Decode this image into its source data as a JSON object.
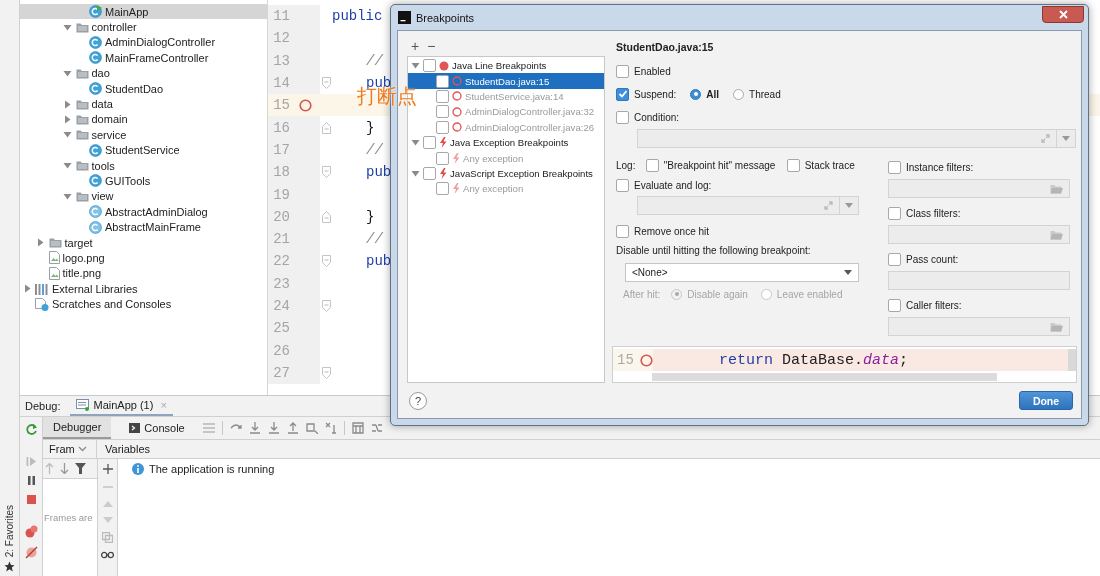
{
  "ide": {
    "favorites_label": "2: Favorites",
    "project_tree": [
      {
        "children": [
          {
            "children": [
              {
                "children": [
                  {
                    "children": [
                      {
                        "label": "MainApp",
                        "kind": "main_class",
                        "selected": true
                      }
                    ]
                  },
                  {
                    "label": "controller",
                    "kind": "folder",
                    "expanded": true,
                    "selected": false,
                    "children": [
                      {
                        "label": "AdminDialogController",
                        "kind": "class",
                        "selected": false
                      },
                      {
                        "label": "MainFrameController",
                        "kind": "class",
                        "selected": false
                      }
                    ]
                  },
                  {
                    "label": "dao",
                    "kind": "folder",
                    "expanded": true,
                    "selected": false,
                    "children": [
                      {
                        "label": "StudentDao",
                        "kind": "class",
                        "selected": false
                      }
                    ]
                  },
                  {
                    "label": "data",
                    "kind": "folder",
                    "expanded": false,
                    "selected": false
                  },
                  {
                    "label": "domain",
                    "kind": "folder",
                    "expanded": false,
                    "selected": false
                  },
                  {
                    "label": "service",
                    "kind": "folder",
                    "expanded": true,
                    "selected": false,
                    "children": [
                      {
                        "label": "StudentService",
                        "kind": "class",
                        "selected": false
                      }
                    ]
                  },
                  {
                    "label": "tools",
                    "kind": "folder",
                    "expanded": true,
                    "selected": false,
                    "children": [
                      {
                        "label": "GUITools",
                        "kind": "class",
                        "selected": false
                      }
                    ]
                  },
                  {
                    "label": "view",
                    "kind": "folder",
                    "expanded": true,
                    "selected": false,
                    "children": [
                      {
                        "label": "AbstractAdminDialog",
                        "kind": "abstract_class",
                        "selected": false
                      },
                      {
                        "label": "AbstractMainFrame",
                        "kind": "abstract_class",
                        "selected": false
                      }
                    ]
                  }
                ]
              }
            ]
          },
          {
            "label": "target",
            "kind": "folder",
            "expanded": false,
            "selected": false
          },
          {
            "label": "logo.png",
            "kind": "image",
            "selected": false
          },
          {
            "label": "title.png",
            "kind": "image",
            "selected": false
          }
        ]
      },
      {
        "label": "External Libraries",
        "kind": "libraries",
        "expanded": false,
        "selected": false
      },
      {
        "label": "Scratches and Consoles",
        "kind": "scratches",
        "selected": false
      }
    ],
    "editor": {
      "annotation": "打断点",
      "lines": [
        {
          "number": "11",
          "code": "public",
          "kind": "declaration",
          "breakpoint": false,
          "current": false,
          "fold_start": false,
          "fold_end": false
        },
        {
          "number": "12",
          "breakpoint": false,
          "current": false,
          "fold_start": false,
          "fold_end": false
        },
        {
          "number": "13",
          "code": "//",
          "kind": "comment",
          "breakpoint": false,
          "current": false,
          "fold_start": false,
          "fold_end": false
        },
        {
          "number": "14",
          "code": "pub",
          "kind": "keyword",
          "breakpoint": false,
          "current": false,
          "fold_start": true,
          "fold_end": false
        },
        {
          "number": "15",
          "breakpoint": true,
          "current": true,
          "fold_start": false,
          "fold_end": false
        },
        {
          "number": "16",
          "code": "}",
          "kind": "brace",
          "breakpoint": false,
          "current": false,
          "fold_start": false,
          "fold_end": true
        },
        {
          "number": "17",
          "code": "//",
          "kind": "comment",
          "breakpoint": false,
          "current": false,
          "fold_start": false,
          "fold_end": false
        },
        {
          "number": "18",
          "code": "pub",
          "kind": "keyword",
          "breakpoint": false,
          "current": false,
          "fold_start": true,
          "fold_end": false
        },
        {
          "number": "19",
          "breakpoint": false,
          "current": false,
          "fold_start": false,
          "fold_end": false
        },
        {
          "number": "20",
          "code": "}",
          "kind": "brace",
          "breakpoint": false,
          "current": false,
          "fold_start": false,
          "fold_end": true
        },
        {
          "number": "21",
          "code": "//",
          "kind": "comment",
          "breakpoint": false,
          "current": false,
          "fold_start": false,
          "fold_end": false
        },
        {
          "number": "22",
          "code": "pub",
          "kind": "keyword",
          "breakpoint": false,
          "current": false,
          "fold_start": true,
          "fold_end": false
        },
        {
          "number": "23",
          "breakpoint": false,
          "current": false,
          "fold_start": false,
          "fold_end": false
        },
        {
          "number": "24",
          "breakpoint": false,
          "current": false,
          "fold_start": true,
          "fold_end": false
        },
        {
          "number": "25",
          "breakpoint": false,
          "current": false,
          "fold_start": false,
          "fold_end": false
        },
        {
          "number": "26",
          "breakpoint": false,
          "current": false,
          "fold_start": false,
          "fold_end": false
        },
        {
          "number": "27",
          "breakpoint": false,
          "current": false,
          "fold_start": true,
          "fold_end": false
        }
      ]
    },
    "debug": {
      "label": "Debug:",
      "session_tab": {
        "label": "MainApp (1)",
        "close": "×"
      },
      "tabs": [
        {
          "label": "Debugger",
          "selected": true
        },
        {
          "label": "Console",
          "selected": false
        }
      ],
      "frames_header": "Fram",
      "variables_header": "Variables",
      "frames_placeholder": "Frames are",
      "message": "The application is running"
    }
  },
  "dialog": {
    "title": "Breakpoints",
    "add": "+",
    "remove": "−",
    "groups": [
      {
        "label": "Java Line Breakpoints",
        "kind": "line",
        "expanded": true,
        "checked": false,
        "selected": false,
        "items": [
          {
            "label": "StudentDao.java:15",
            "checked": false,
            "selected": true,
            "enabled": false
          },
          {
            "label": "StudentService.java:14",
            "checked": false,
            "selected": false,
            "enabled": false
          },
          {
            "label": "AdminDialogController.java:32",
            "checked": false,
            "selected": false,
            "enabled": false
          },
          {
            "label": "AdminDialogController.java:26",
            "checked": false,
            "selected": false,
            "enabled": false
          }
        ]
      },
      {
        "label": "Java Exception Breakpoints",
        "kind": "exception",
        "expanded": true,
        "checked": false,
        "selected": false,
        "items": [
          {
            "label": "Any exception",
            "checked": false,
            "selected": false,
            "enabled": false
          }
        ]
      },
      {
        "label": "JavaScript Exception Breakpoints",
        "kind": "exception",
        "expanded": true,
        "checked": false,
        "selected": false,
        "items": [
          {
            "label": "Any exception",
            "checked": false,
            "selected": false,
            "enabled": false
          }
        ]
      }
    ],
    "details": {
      "title": "StudentDao.java:15",
      "enabled": {
        "label": "Enabled",
        "checked": false
      },
      "suspend": {
        "label": "Suspend:",
        "checked": true,
        "options": [
          {
            "label": "All",
            "selected": true
          },
          {
            "label": "Thread",
            "selected": false
          }
        ]
      },
      "condition": {
        "label": "Condition:",
        "checked": false
      },
      "log": {
        "label": "Log:",
        "options": [
          {
            "label": "\"Breakpoint hit\" message",
            "checked": false
          },
          {
            "label": "Stack trace",
            "checked": false
          }
        ]
      },
      "evaluate": {
        "label": "Evaluate and log:",
        "checked": false
      },
      "remove_once_hit": {
        "label": "Remove once hit",
        "checked": false
      },
      "disable_until": {
        "label": "Disable until hitting the following breakpoint:",
        "value": "<None>"
      },
      "after_hit": {
        "label": "After hit:",
        "disabled": true,
        "options": [
          {
            "label": "Disable again",
            "selected": true
          },
          {
            "label": "Leave enabled",
            "selected": false
          }
        ]
      },
      "filters": [
        {
          "label": "Instance filters:",
          "checked": false,
          "kind": "browse"
        },
        {
          "label": "Class filters:",
          "checked": false,
          "kind": "browse"
        },
        {
          "label": "Pass count:",
          "checked": false,
          "kind": "plain"
        },
        {
          "label": "Caller filters:",
          "checked": false,
          "kind": "browse"
        }
      ],
      "preview": {
        "line_number": "15",
        "breakpoint": true,
        "tokens": [
          {
            "text": "return",
            "kind": "keyword"
          },
          {
            "text": " DataBase.",
            "kind": "plain"
          },
          {
            "text": "data",
            "kind": "field"
          },
          {
            "text": ";",
            "kind": "plain"
          }
        ]
      }
    },
    "help": "?",
    "done": "Done"
  }
}
